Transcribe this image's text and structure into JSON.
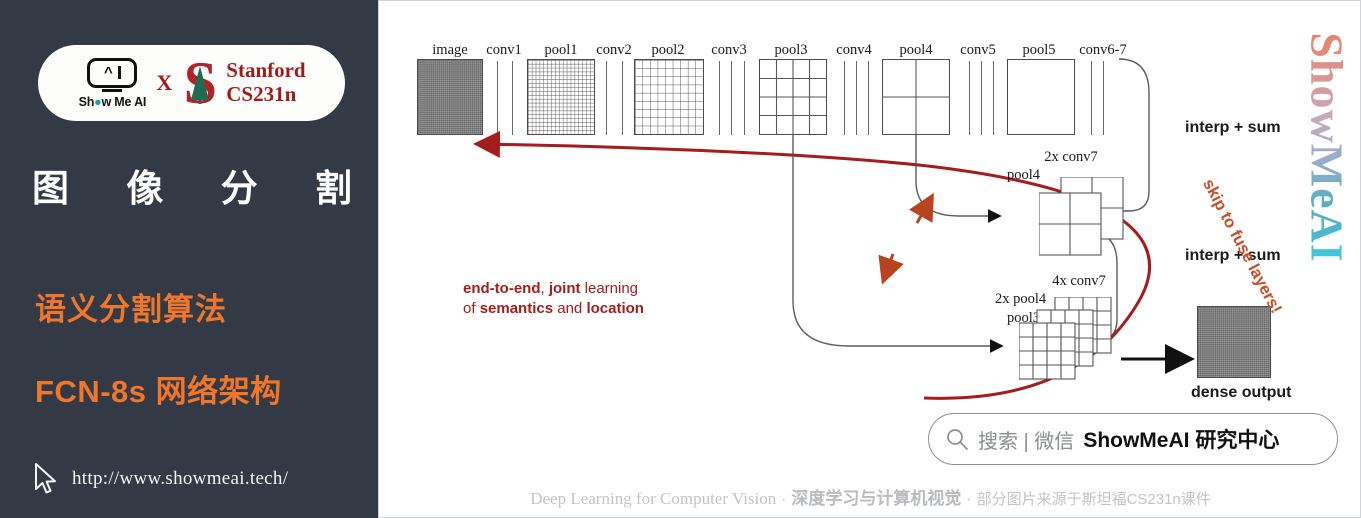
{
  "left": {
    "logo": {
      "showmeai_text": "Show Me AI",
      "x_symbol": "X",
      "stanford_line1": "Stanford",
      "stanford_line2": "CS231n",
      "showmeai_mark_icon": "smiley-screen-icon",
      "stanford_tree_icon": "stanford-tree-icon"
    },
    "title_chars": [
      "图",
      "像",
      "分",
      "割"
    ],
    "subtitle_1": "语义分割算法",
    "subtitle_2": "FCN-8s 网络架构",
    "url": "http://www.showmeai.tech/",
    "cursor_icon": "mouse-cursor-icon",
    "bg_color": "#333a45",
    "accent_color": "#f0762a"
  },
  "figure": {
    "top_labels": [
      "image",
      "conv1",
      "pool1",
      "conv2",
      "pool2",
      "conv3",
      "pool3",
      "conv4",
      "pool4",
      "conv5",
      "pool5",
      "conv6-7"
    ],
    "skip_block_labels": {
      "upper_top": "2x conv7",
      "upper_left": "pool4",
      "lower_top": "4x conv7",
      "lower_mid": "2x pool4",
      "lower_left": "pool3"
    },
    "interp_sum_upper": "interp + sum",
    "interp_sum_lower": "interp + sum",
    "dense_output": "dense output",
    "red_annotation_line1_a": "end-to-end",
    "red_annotation_line1_b": ", ",
    "red_annotation_line1_c": "joint",
    "red_annotation_line1_d": " learning",
    "red_annotation_line2_a": "of ",
    "red_annotation_line2_b": "semantics",
    "red_annotation_line2_c": " and ",
    "red_annotation_line2_d": "location",
    "skip_annotation": "skip to fuse layers!",
    "red_color": "#a51c1c",
    "skip_color": "#cb4b24"
  },
  "watermark": {
    "text": "ShowMeAI"
  },
  "search": {
    "icon": "magnifier-icon",
    "label": "搜索 | 微信",
    "brand": "ShowMeAI 研究中心"
  },
  "footer": {
    "english": "Deep Learning for Computer Vision",
    "sep1": "·",
    "chinese_bold": "深度学习与计算机视觉",
    "sep2": "·",
    "chinese_small": "部分图片来源于斯坦福CS231n课件"
  }
}
